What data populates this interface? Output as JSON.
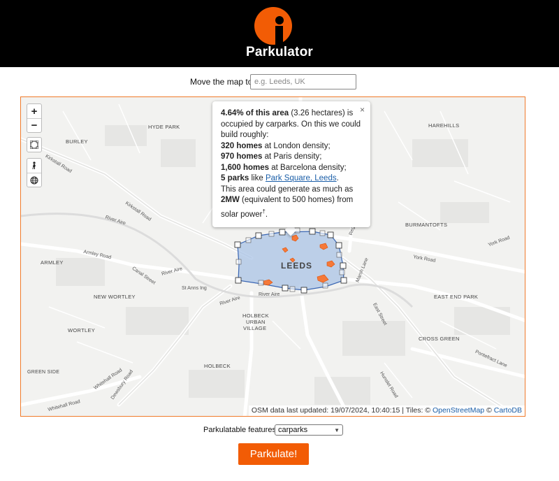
{
  "brand": {
    "name": "Parkulator",
    "accent": "#f25c05"
  },
  "search": {
    "label": "Move the map to:",
    "placeholder": "e.g. Leeds, UK"
  },
  "map_controls": {
    "zoom_in": "+",
    "zoom_out": "−",
    "draw_tool_icon": "polygon-draw-icon",
    "person_tool_icon": "walker-icon",
    "globe_tool_icon": "globe-icon"
  },
  "map_places": {
    "hyde_park": "HYDE PARK",
    "burley": "BURLEY",
    "harehills": "HAREHILLS",
    "burmantofts": "BURMANTOFTS",
    "armley": "ARMLEY",
    "new_wortley": "NEW WORTLEY",
    "wortley": "WORTLEY",
    "holbeck_urban_village_1": "HOLBECK",
    "holbeck_urban_village_2": "URBAN",
    "holbeck_urban_village_3": "VILLAGE",
    "holbeck": "HOLBECK",
    "east_end_park": "EAST END PARK",
    "cross_green": "CROSS GREEN",
    "green_side": "GREEN SIDE",
    "leeds": "LEEDS"
  },
  "map_roads": {
    "kirkstall_road": "Kirkstall Road",
    "kirkstall_road_2": "Kirkstall Road",
    "river_aire_1": "River Aire",
    "river_aire_2": "River Aire",
    "river_aire_3": "River Aire",
    "river_aire_4": "River Aire",
    "armley_road": "Armley Road",
    "canal_street": "Canal Street",
    "st_anns_ing": "St Anns Ing",
    "york_road": "York Road",
    "york_road_2": "York Road",
    "marsh_lane": "Marsh Lane",
    "east_street": "East Street",
    "whitehall_road": "Whitehall Road",
    "whitehall_road_2": "Whitehall Road",
    "dewsbury_road": "Dewsbury Road",
    "hunslet_road": "Hunslet Road",
    "pontefract_lane": "Pontefract Lane",
    "regent": "Regent"
  },
  "popup": {
    "close": "×",
    "pct": "4.64% of this area",
    "hectares": " (3.26 hectares) is occupied by carparks. On this we could build roughly:",
    "london_homes": "320 homes",
    "london_text": " at London density;",
    "paris_homes": "970 homes",
    "paris_text": " at Paris density;",
    "barcelona_homes": "1,600 homes",
    "barcelona_text": " at Barcelona density;",
    "parks_count": "5 parks",
    "parks_text": " like ",
    "parks_link": "Park Square, Leeds",
    "parks_end": ".",
    "solar_text": "This area could generate as much as ",
    "solar_power": "2MW",
    "solar_rest": " (equivalent to 500 homes) from solar power",
    "dagger": "†",
    "solar_end": "."
  },
  "attribution": {
    "osm_updated": "OSM data last updated: 19/07/2024, 10:40:15 | Tiles: © ",
    "osm_link": "OpenStreetMap",
    "sep": " © ",
    "carto_link": "CartoDB"
  },
  "features": {
    "label": "Parkulatable features:",
    "selected": "carparks"
  },
  "action": {
    "label": "Parkulate!"
  }
}
